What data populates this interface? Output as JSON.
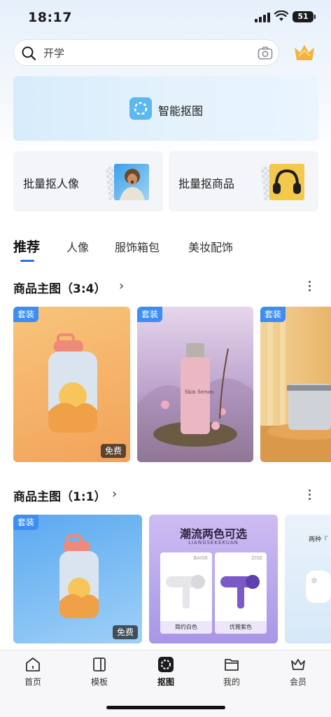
{
  "status_bar": {
    "time": "18:17",
    "battery": "51"
  },
  "search": {
    "value": "开学",
    "icons": [
      "search-icon",
      "camera-icon",
      "crown-icon"
    ]
  },
  "smart_cutout": {
    "label": "智能抠图"
  },
  "features": [
    {
      "label": "批量抠人像"
    },
    {
      "label": "批量抠商品"
    }
  ],
  "tabs": [
    {
      "label": "推荐",
      "active": true
    },
    {
      "label": "人像"
    },
    {
      "label": "服饰箱包"
    },
    {
      "label": "美妆配饰"
    }
  ],
  "sections": [
    {
      "title": "商品主图（3:4）",
      "cards": [
        {
          "tag": "套装",
          "badge": "免费"
        },
        {
          "tag": "套装",
          "bottle_label": "Skin Serum"
        },
        {
          "tag": "套装"
        }
      ]
    },
    {
      "title": "商品主图（1:1）",
      "cards": [
        {
          "tag": "套装",
          "badge": "免费"
        },
        {
          "headline": "潮流两色可选",
          "subline": "LIANGSEKEKUAN",
          "left_caption": "BAISE",
          "left_label": "简约白色",
          "right_caption": "ZISE",
          "right_label": "优雅紫色"
        },
        {
          "partial_text": "两种『"
        }
      ]
    }
  ],
  "bottom_nav": [
    {
      "label": "首页"
    },
    {
      "label": "模板"
    },
    {
      "label": "抠图",
      "active": true
    },
    {
      "label": "我的"
    },
    {
      "label": "会员"
    }
  ],
  "colors": {
    "accent": "#2f6fe4",
    "tag": "#3d8ef0",
    "smart_icon": "#5cb8f0",
    "crown": "#f5b23a"
  }
}
